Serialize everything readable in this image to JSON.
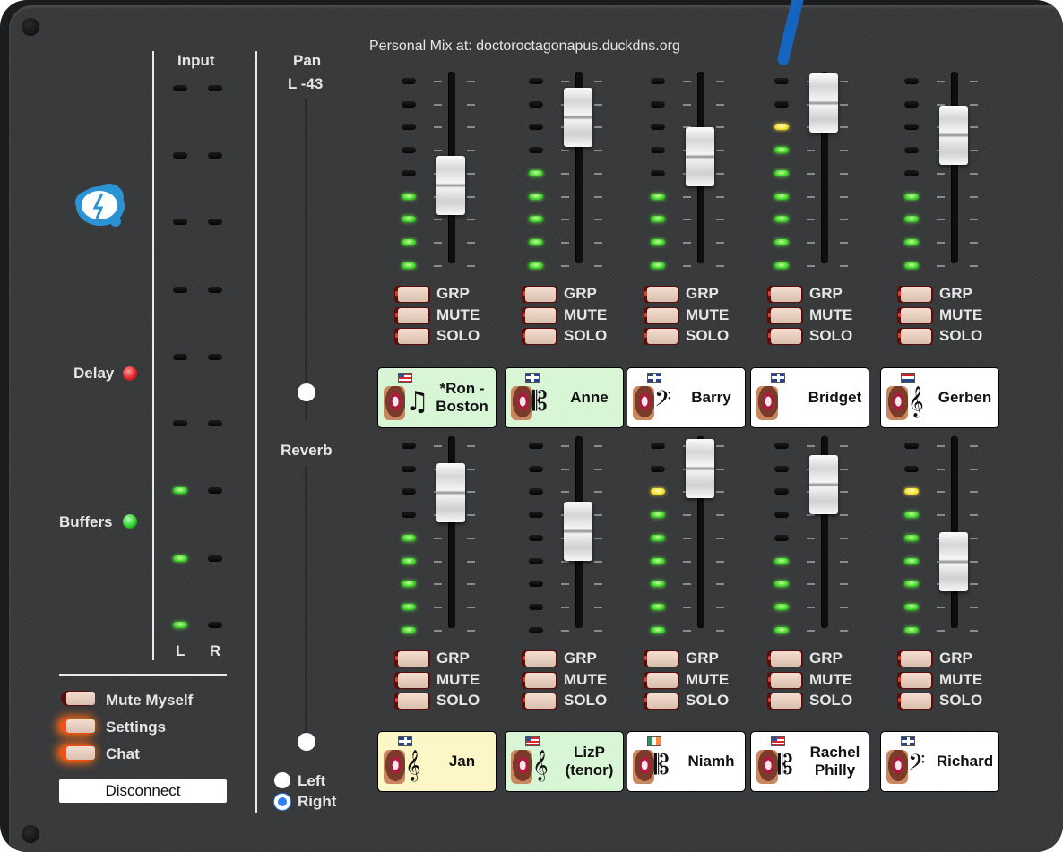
{
  "header": {
    "personal_mix": "Personal Mix at: doctoroctagonapus.duckdns.org"
  },
  "input": {
    "title": "Input",
    "left_label": "L",
    "right_label": "R"
  },
  "status": {
    "delay_label": "Delay",
    "buffers_label": "Buffers",
    "delay_color": "#e0252a",
    "buffers_color": "#2fcf2f"
  },
  "pan": {
    "title": "Pan",
    "value": "L -43"
  },
  "reverb": {
    "title": "Reverb",
    "left_label": "Left",
    "right_label": "Right",
    "selected": "Right"
  },
  "controls": {
    "mute_myself": "Mute Myself",
    "settings": "Settings",
    "chat": "Chat",
    "disconnect": "Disconnect"
  },
  "channel_buttons": {
    "grp": "GRP",
    "mute": "MUTE",
    "solo": "SOLO"
  },
  "colors": {
    "panel": "#38393b",
    "accent": "#1565c0",
    "led_green": "#3fd32a",
    "led_yellow": "#f6e331"
  },
  "channels": [
    {
      "name": "*Ron - Boston",
      "flag": "US",
      "instrument": "music-note-icon",
      "card_color": "#d8f5d6",
      "lit": 4,
      "warn": false
    },
    {
      "name": "Anne",
      "flag": "GB",
      "instrument": "alto-clef-icon",
      "card_color": "#d8f5d6",
      "lit": 5,
      "warn": false
    },
    {
      "name": "Barry",
      "flag": "GB",
      "instrument": "bass-clef-icon",
      "card_color": "#ffffff",
      "lit": 4,
      "warn": false
    },
    {
      "name": "Bridget",
      "flag": "GB",
      "instrument": "speaking-head-icon",
      "card_color": "#ffffff",
      "lit": 6,
      "warn": true
    },
    {
      "name": "Gerben",
      "flag": "NL",
      "instrument": "treble-clef-icon",
      "card_color": "#ffffff",
      "lit": 4,
      "warn": false
    },
    {
      "name": "Jan",
      "flag": "GB",
      "instrument": "treble-clef-icon",
      "card_color": "#fdf7c8",
      "lit": 5,
      "warn": false
    },
    {
      "name": "LizP (tenor)",
      "flag": "US",
      "instrument": "treble-clef-icon",
      "card_color": "#d8f5d6",
      "lit": 0,
      "warn": false
    },
    {
      "name": "Niamh",
      "flag": "IE",
      "instrument": "alto-clef-icon",
      "card_color": "#ffffff",
      "lit": 6,
      "warn": true
    },
    {
      "name": "Rachel Philly",
      "flag": "US",
      "instrument": "alto-clef-icon",
      "card_color": "#ffffff",
      "lit": 4,
      "warn": false
    },
    {
      "name": "Richard",
      "flag": "GB",
      "instrument": "bass-clef-icon",
      "card_color": "#ffffff",
      "lit": 6,
      "warn": true
    }
  ]
}
